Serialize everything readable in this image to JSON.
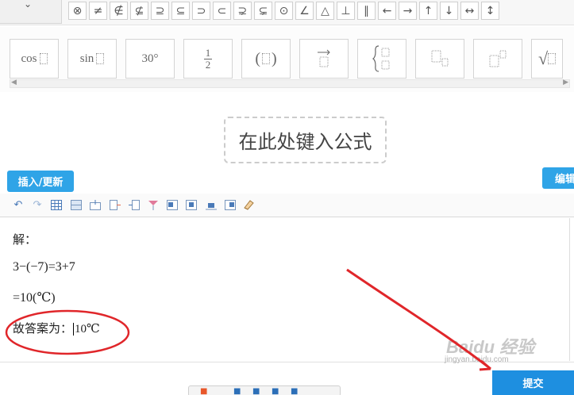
{
  "symbols_row": {
    "items": [
      {
        "glyph": "⊗",
        "icon": "circled-times-icon"
      },
      {
        "glyph": "≠",
        "icon": "not-equal-icon"
      },
      {
        "glyph": "∉",
        "icon": "not-element-of-icon"
      },
      {
        "glyph": "⊈",
        "icon": "not-subset-icon"
      },
      {
        "glyph": "⊇",
        "icon": "superset-equal-icon"
      },
      {
        "glyph": "⊆",
        "icon": "subset-equal-icon"
      },
      {
        "glyph": "⊃",
        "icon": "superset-icon"
      },
      {
        "glyph": "⊂",
        "icon": "subset-icon"
      },
      {
        "glyph": "⊋",
        "icon": "proper-superset-icon"
      },
      {
        "glyph": "⊊",
        "icon": "proper-subset-icon"
      },
      {
        "glyph": "⊙",
        "icon": "circled-dot-icon"
      },
      {
        "glyph": "∠",
        "icon": "angle-icon"
      },
      {
        "glyph": "△",
        "icon": "triangle-icon"
      },
      {
        "glyph": "⊥",
        "icon": "perpendicular-icon"
      },
      {
        "glyph": "∥",
        "icon": "parallel-icon"
      },
      {
        "glyph": "←",
        "icon": "arrow-left-icon"
      },
      {
        "glyph": "→",
        "icon": "arrow-right-icon"
      },
      {
        "glyph": "↑",
        "icon": "arrow-up-icon"
      },
      {
        "glyph": "↓",
        "icon": "arrow-down-icon"
      },
      {
        "glyph": "↔",
        "icon": "arrow-left-right-icon"
      },
      {
        "glyph": "↕",
        "icon": "arrow-up-down-icon"
      }
    ]
  },
  "templates": {
    "cos": "cos",
    "sin": "sin",
    "degree": "30°",
    "frac_num": "1",
    "frac_den": "2",
    "paren_open": "(",
    "paren_close": ")",
    "sqrt": "√"
  },
  "formula": {
    "placeholder": "在此处键入公式"
  },
  "buttons": {
    "insert": "插入/更新",
    "edit": "编辑",
    "submit": "提交"
  },
  "editor": {
    "line1": "解：",
    "line2": "3−(−7)=3+7",
    "line3": "=10(℃)",
    "line4_label": "故答案为：",
    "line4_value": "10℃"
  },
  "watermark": {
    "main": "Baidu 经验",
    "sub": "jingyan.baidu.com"
  },
  "annotation_colors": {
    "red": "#e0262a"
  }
}
